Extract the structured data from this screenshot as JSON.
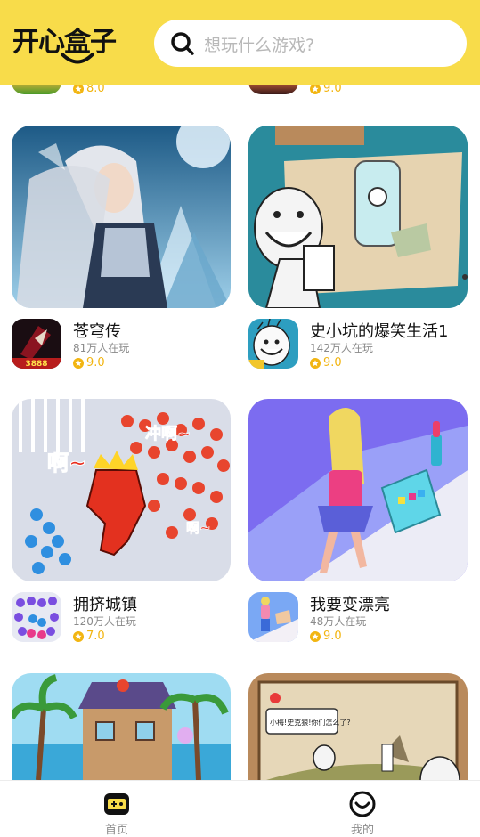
{
  "header": {
    "logo_text": "开心盒子",
    "search_placeholder": "想玩什么游戏?"
  },
  "partial_row": [
    {
      "rating": "8.0"
    },
    {
      "rating": "9.0"
    }
  ],
  "games": [
    {
      "name": "苍穹传",
      "players": "81万人在玩",
      "rating": "9.0"
    },
    {
      "name": "史小坑的爆笑生活1",
      "players": "142万人在玩",
      "rating": "9.0"
    },
    {
      "name": "拥挤城镇",
      "players": "120万人在玩",
      "rating": "7.0"
    },
    {
      "name": "我要变漂亮",
      "players": "48万人在玩",
      "rating": "9.0"
    }
  ],
  "thumb_text": {
    "crowd_a": "啊~",
    "crowd_b": "冲啊~",
    "crowd_c": "啊~",
    "icon_badge": "3888",
    "comic_bubble": "小梅!史克狼!你们怎么了?"
  },
  "bottom_nav": [
    {
      "label": "首页",
      "icon": "gamepad-icon"
    },
    {
      "label": "我的",
      "icon": "smile-face-icon"
    }
  ],
  "colors": {
    "brand_yellow": "#f8dc4a",
    "rating_gold": "#f2b511"
  }
}
